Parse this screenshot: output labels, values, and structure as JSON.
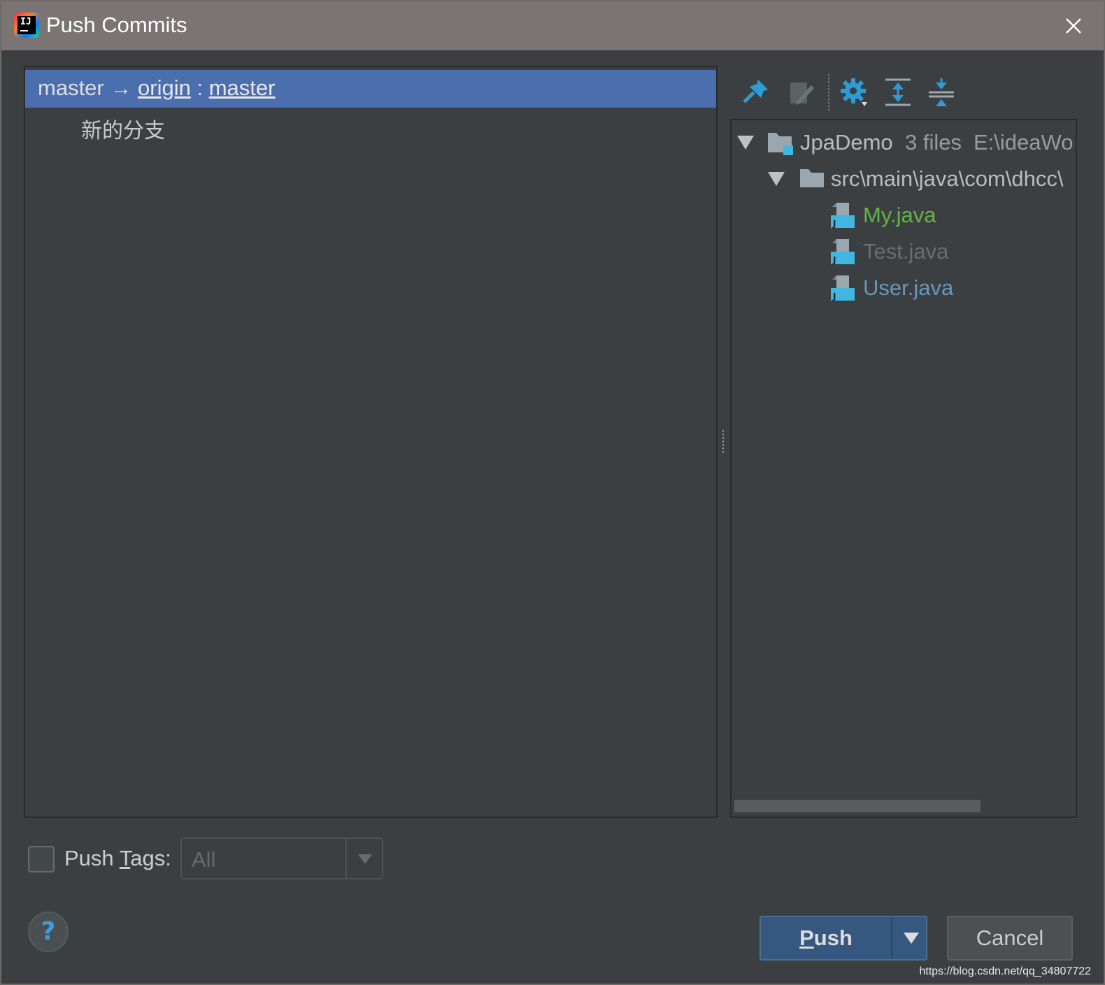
{
  "window": {
    "title": "Push Commits",
    "app_icon_text": "IJ"
  },
  "commits": {
    "branch": {
      "local": "master",
      "arrow": "→",
      "remote": "origin",
      "separator": ":",
      "remote_branch": "master"
    },
    "items": [
      {
        "message": "新的分支"
      }
    ]
  },
  "toolbar": {
    "icons": [
      "pin-icon",
      "edit-source-icon",
      "settings-icon",
      "expand-all-icon",
      "collapse-all-icon"
    ]
  },
  "tree": {
    "root": {
      "name": "JpaDemo",
      "count": "3 files",
      "path": "E:\\ideaWo"
    },
    "folder": {
      "path": "src\\main\\java\\com\\dhcc\\"
    },
    "files": [
      {
        "name": "My.java",
        "status": "added",
        "color": "#62b543"
      },
      {
        "name": "Test.java",
        "status": "deleted",
        "color": "#6c6c6c"
      },
      {
        "name": "User.java",
        "status": "modified",
        "color": "#6897bb"
      }
    ]
  },
  "footer": {
    "push_tags_pre": "Push ",
    "push_tags_mn": "T",
    "push_tags_post": "ags:",
    "push_tags_checked": false,
    "tags_select_value": "All",
    "help_label": "?",
    "push_pre": "",
    "push_mn": "P",
    "push_post": "ush",
    "cancel_label": "Cancel"
  },
  "watermark": "https://blog.csdn.net/qq_34807722",
  "colors": {
    "accent": "#4b6eaf",
    "push_button": "#365880",
    "title_bar": "#7a7474",
    "background": "#3c3f41"
  }
}
